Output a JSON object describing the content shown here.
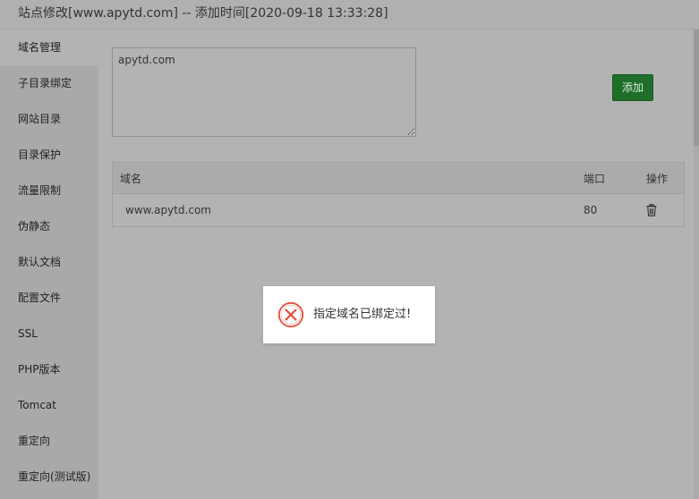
{
  "window": {
    "title": "站点修改[www.apytd.com] -- 添加时间[2020-09-18 13:33:28]"
  },
  "sidebar": {
    "items": [
      {
        "label": "域名管理",
        "active": true
      },
      {
        "label": "子目录绑定"
      },
      {
        "label": "网站目录"
      },
      {
        "label": "目录保护"
      },
      {
        "label": "流量限制"
      },
      {
        "label": "伪静态"
      },
      {
        "label": "默认文档"
      },
      {
        "label": "配置文件"
      },
      {
        "label": "SSL"
      },
      {
        "label": "PHP版本"
      },
      {
        "label": "Tomcat"
      },
      {
        "label": "重定向"
      },
      {
        "label": "重定向(测试版)"
      }
    ]
  },
  "domain_form": {
    "input_value": "apytd.com",
    "add_label": "添加"
  },
  "domain_table": {
    "headers": {
      "domain": "域名",
      "port": "端口",
      "action": "操作"
    },
    "rows": [
      {
        "domain": "www.apytd.com",
        "port": "80",
        "action_icon": "trash-icon"
      }
    ]
  },
  "dialog": {
    "message": "指定域名已绑定过!",
    "icon": "error-circle-icon",
    "icon_color": "#e74c3c"
  },
  "colors": {
    "add_button": "#1f6e2a",
    "overlay_bg": "#b3b3b3"
  }
}
